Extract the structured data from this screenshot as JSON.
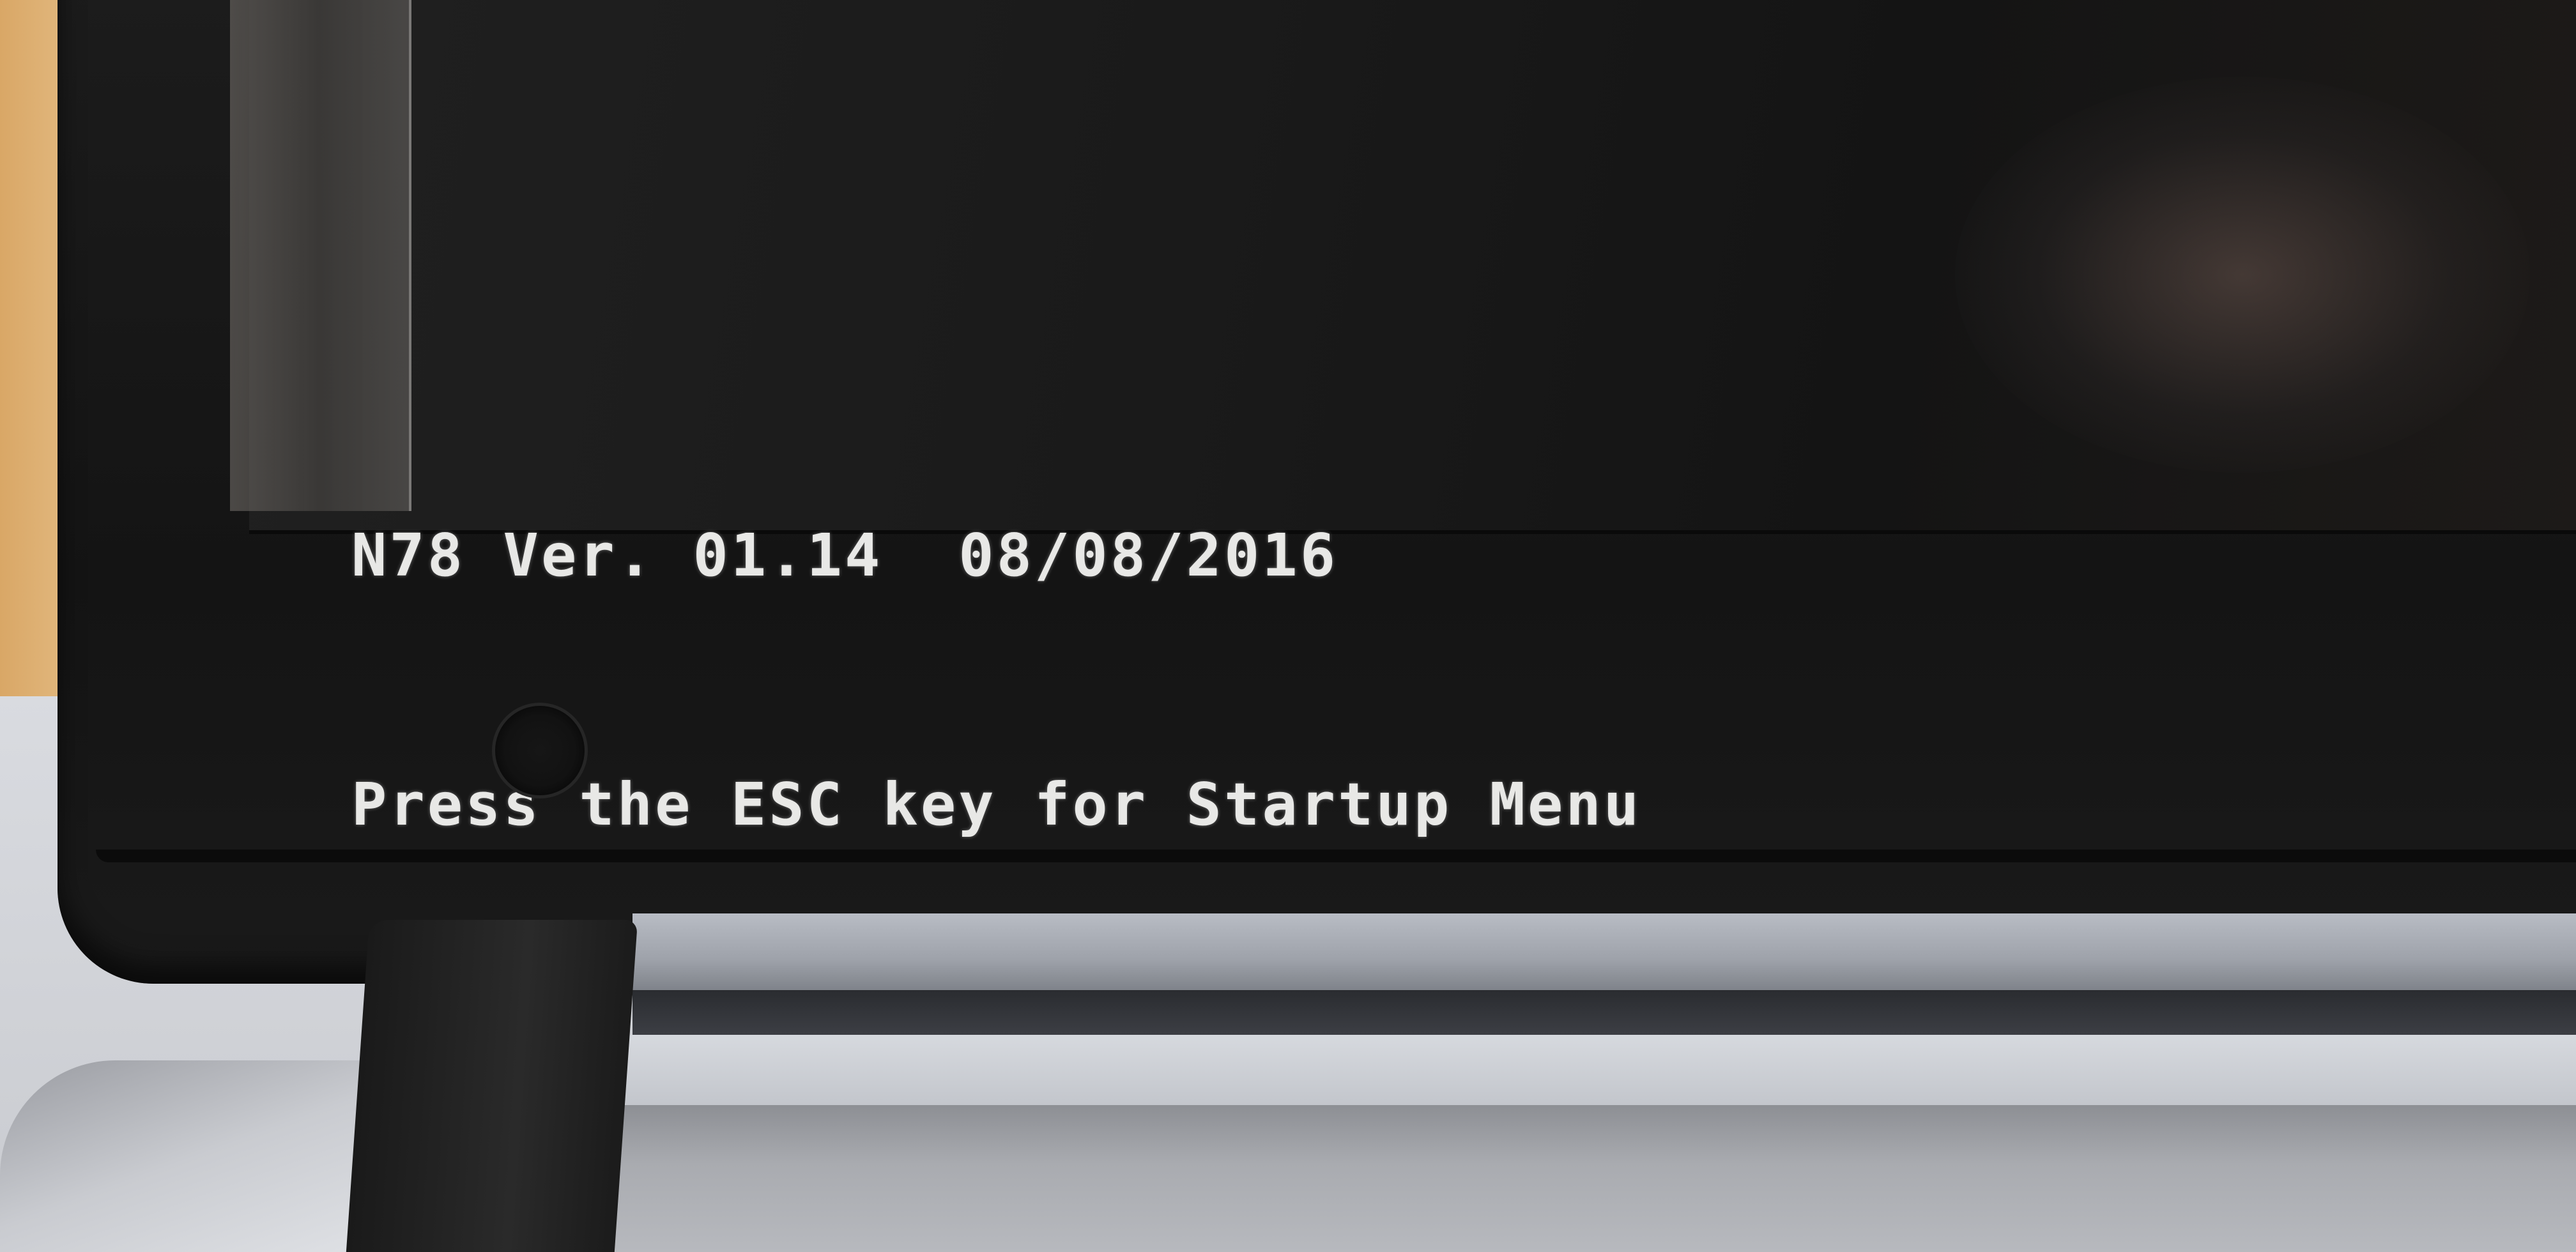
{
  "bios": {
    "version_line": "N78 Ver. 01.14  08/08/2016",
    "prompt_line": "Press the ESC key for Startup Menu"
  }
}
